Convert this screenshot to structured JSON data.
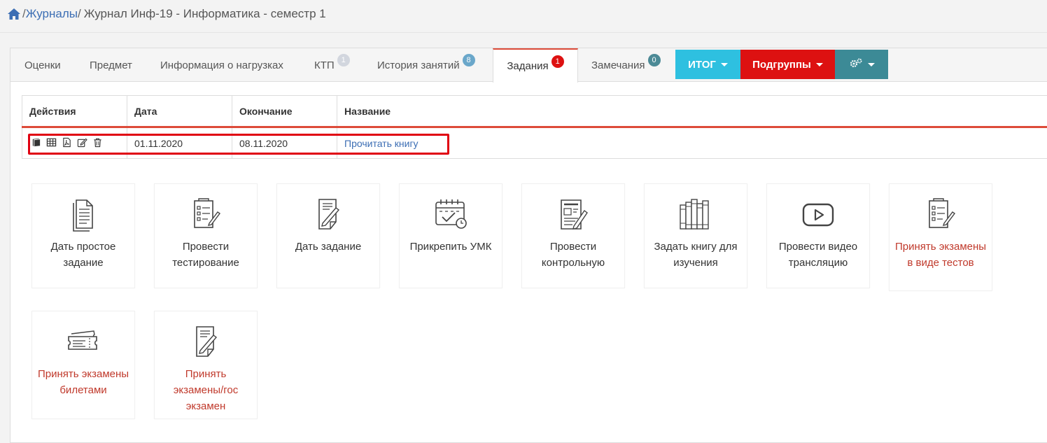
{
  "breadcrumb": {
    "home_icon": "home-icon",
    "sep1": "/",
    "journals": "Журналы",
    "sep2": "/",
    "current": "Журнал Инф-19 - Информатика - семестр 1"
  },
  "tabs": [
    {
      "label": "Оценки",
      "badge": ""
    },
    {
      "label": "Предмет",
      "badge": ""
    },
    {
      "label": "Информация о нагрузках",
      "badge": ""
    },
    {
      "label": "КТП",
      "badge": "1"
    },
    {
      "label": "История занятий",
      "badge": "8"
    },
    {
      "label": "Задания",
      "badge": "1"
    },
    {
      "label": "Замечания",
      "badge": "0"
    }
  ],
  "buttons": {
    "itog": "ИТОГ",
    "itog_color": "#2ec0e0",
    "subgroups": "Подгруппы",
    "subgroups_color": "#dd1111",
    "settings_icon": "gears-icon",
    "settings_color": "#3c8a96"
  },
  "table": {
    "headers": [
      "Действия",
      "Дата",
      "Окончание",
      "Название"
    ],
    "rows": [
      {
        "icons": [
          "book-icon",
          "table-icon",
          "pdf-icon",
          "edit-icon",
          "trash-icon"
        ],
        "date": "01.11.2020",
        "end": "08.11.2020",
        "name": "Прочитать книгу"
      }
    ]
  },
  "cards": [
    {
      "label": "Дать простое задание",
      "icon": "document-icon",
      "red": false
    },
    {
      "label": "Провести тестирование",
      "icon": "checklist-pen-icon",
      "red": false
    },
    {
      "label": "Дать задание",
      "icon": "document-pen-icon",
      "red": false
    },
    {
      "label": "Прикрепить УМК",
      "icon": "calendar-check-icon",
      "red": false
    },
    {
      "label": "Провести контрольную",
      "icon": "newspaper-pen-icon",
      "red": false
    },
    {
      "label": "Задать книгу для изучения",
      "icon": "books-icon",
      "red": false
    },
    {
      "label": "Провести видео трансляцию",
      "icon": "video-play-icon",
      "red": false
    },
    {
      "label": "Принять экзамены в виде тестов",
      "icon": "checklist-pen-icon",
      "red": true
    },
    {
      "label": "Принять экзамены билетами",
      "icon": "tickets-icon",
      "red": true
    },
    {
      "label": "Принять экзамены/гос экзамен",
      "icon": "document-pen-icon",
      "red": true
    }
  ],
  "colors": {
    "accent_red": "#dd4b39",
    "link_blue": "#3c6eb4",
    "highlight_red": "#e00012"
  }
}
